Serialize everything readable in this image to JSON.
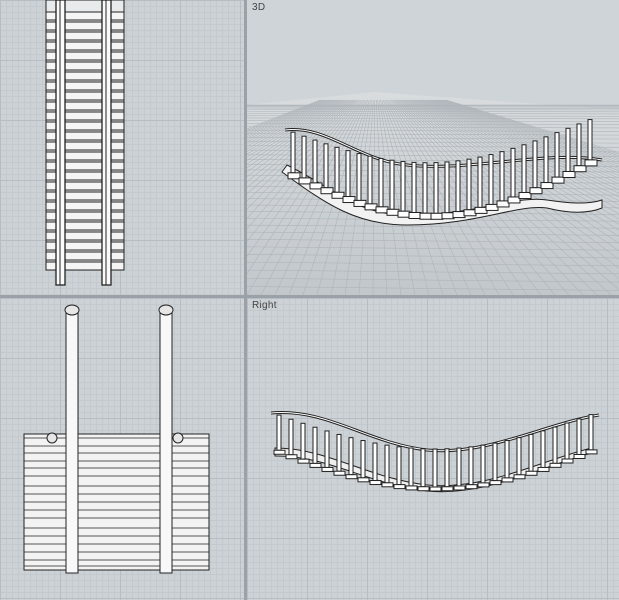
{
  "viewports": {
    "top": {
      "label": ""
    },
    "perspective": {
      "label": "3D"
    },
    "front": {
      "label": ""
    },
    "right": {
      "label": "Right"
    }
  },
  "colors": {
    "viewport_bg": "#cdd2d6",
    "grid_major": "#b7bdc2",
    "border": "#9aa1a8",
    "wire": "#1a1a1a",
    "fill": "#ffffff"
  }
}
